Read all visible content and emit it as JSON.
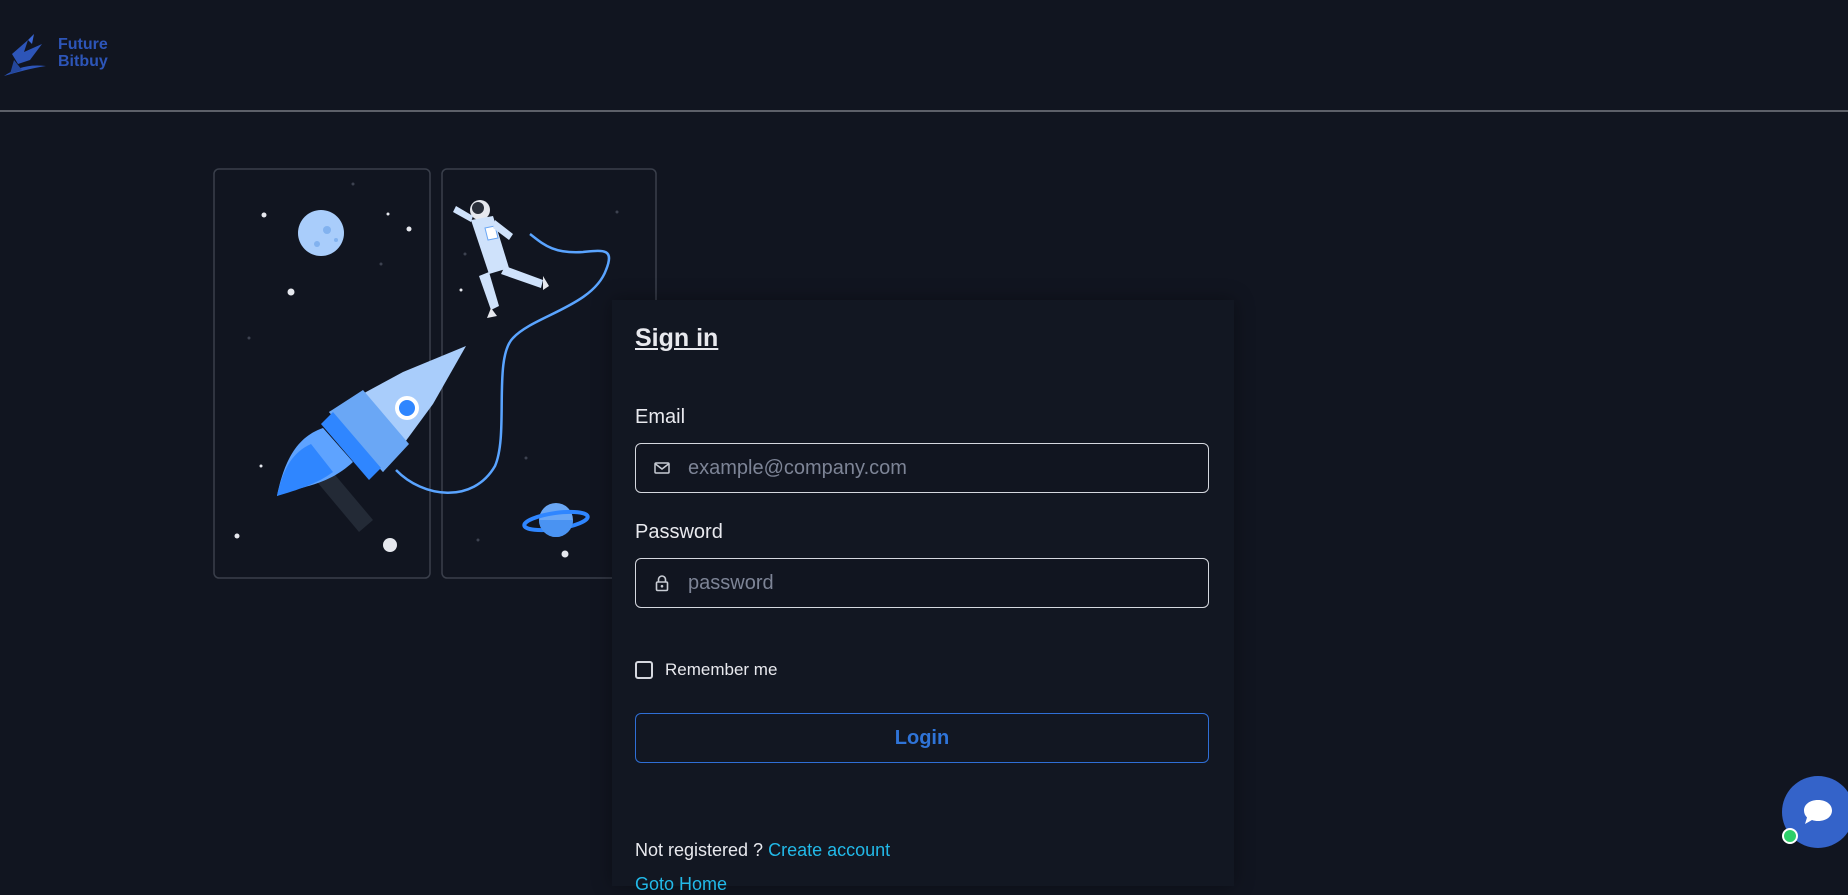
{
  "brand": {
    "line1": "Future",
    "line2": "Bitbuy",
    "color": "#2d55b8"
  },
  "signin": {
    "title": "Sign in",
    "email_label": "Email",
    "email_placeholder": "example@company.com",
    "email_icon": "mail-icon",
    "password_label": "Password",
    "password_placeholder": "password",
    "password_icon": "lock-icon",
    "remember_label": "Remember me",
    "login_label": "Login",
    "not_registered": "Not registered ?",
    "create_account": "Create account",
    "go_home": "Goto Home"
  },
  "colors": {
    "background": "#111520",
    "accent": "#2f74d8",
    "link": "#22b9e8",
    "online": "#2ecf69"
  },
  "chat": {
    "icon": "chat-bubble-icon"
  }
}
